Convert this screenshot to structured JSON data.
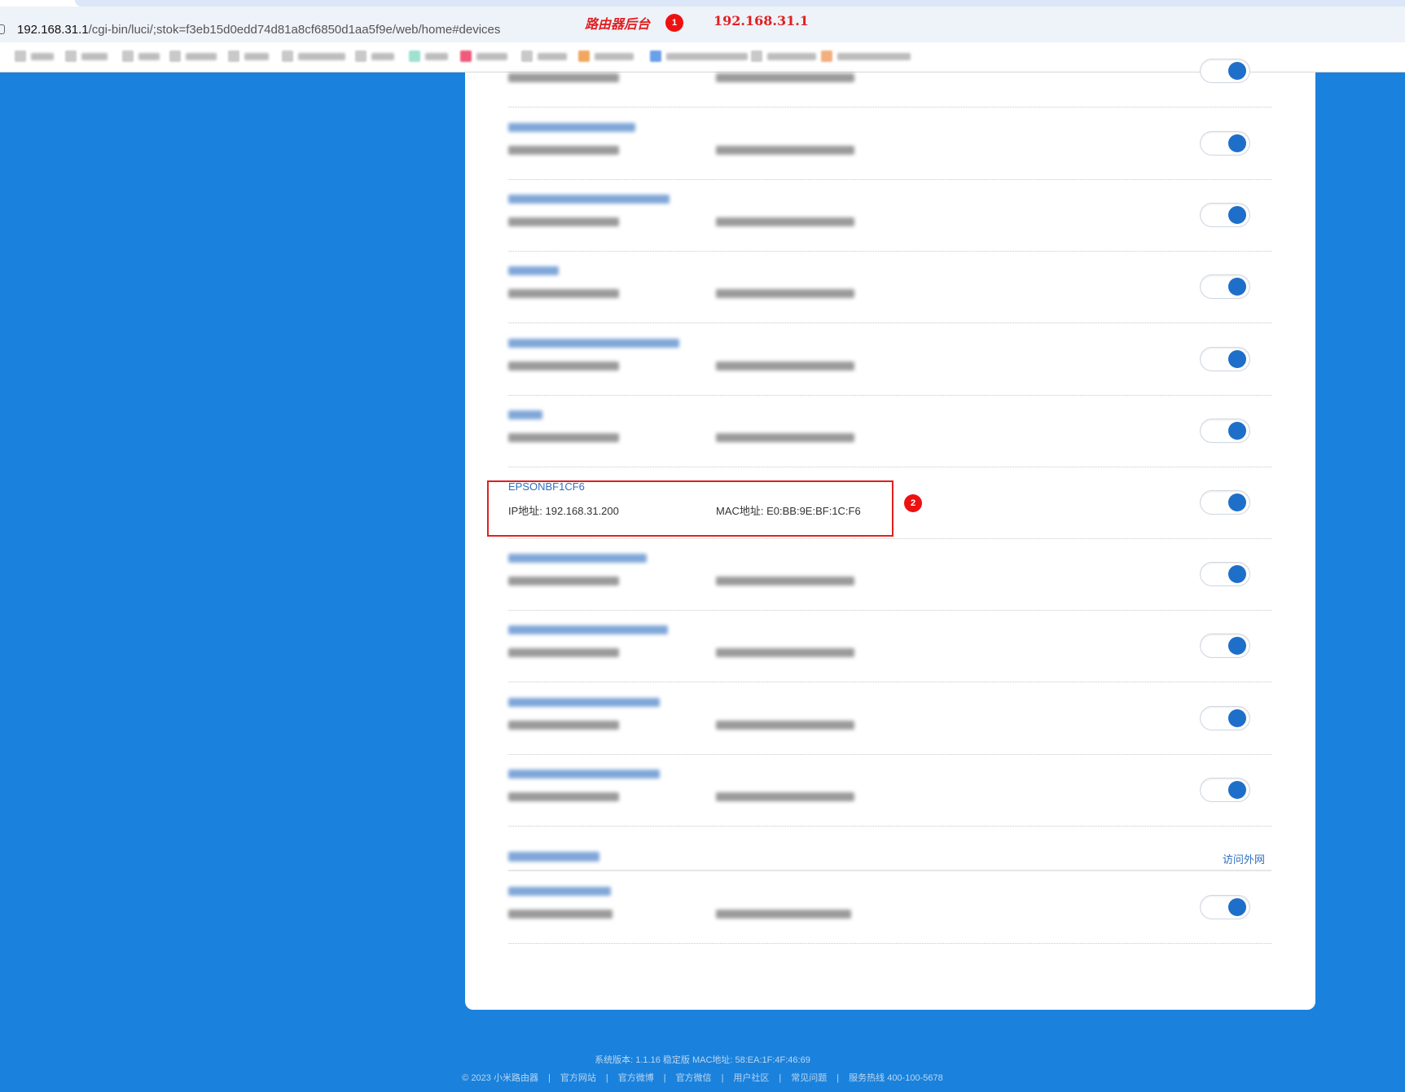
{
  "browser": {
    "url_host": "192.168.31.1",
    "url_path": "/cgi-bin/luci/;stok=f3eb15d0edd74d81a8cf6850d1aa5f9e/web/home#devices"
  },
  "annotations": {
    "title": "路由器后台",
    "ip": "192.168.31.1",
    "badge1": "1",
    "badge2": "2"
  },
  "device_highlight": {
    "name": "EPSONBF1CF6",
    "ip": "IP地址: 192.168.31.200",
    "mac": "MAC地址: E0:BB:9E:BF:1C:F6"
  },
  "section": {
    "visit_label": "访问外网"
  },
  "footer": {
    "line1": "系统版本: 1.1.16 稳定版  MAC地址: 58:EA:1F:4F:46:69",
    "copyright": "© 2023 小米路由器",
    "links": [
      "官方网站",
      "官方微博",
      "官方微信",
      "用户社区",
      "常见问题",
      "服务热线 400-100-5678"
    ]
  },
  "colors": {
    "background": "#1a82dc",
    "accent": "#1e6fc9",
    "annotation": "#e02020"
  }
}
